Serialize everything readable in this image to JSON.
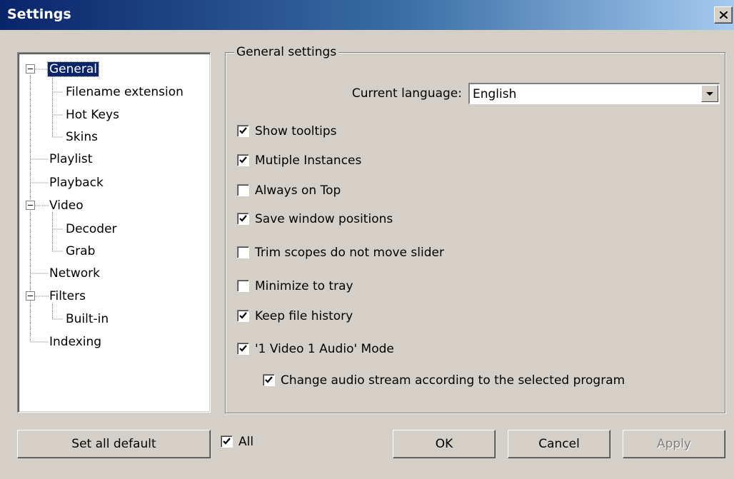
{
  "window": {
    "title": "Settings"
  },
  "tree": {
    "items": [
      {
        "label": "General",
        "selected": true
      },
      {
        "label": "Filename extension"
      },
      {
        "label": "Hot Keys"
      },
      {
        "label": "Skins"
      },
      {
        "label": "Playlist"
      },
      {
        "label": "Playback"
      },
      {
        "label": "Video"
      },
      {
        "label": "Decoder"
      },
      {
        "label": "Grab"
      },
      {
        "label": "Network"
      },
      {
        "label": "Filters"
      },
      {
        "label": "Built-in"
      },
      {
        "label": "Indexing"
      }
    ]
  },
  "general": {
    "legend": "General settings",
    "language_label": "Current language:",
    "language_value": "English",
    "checkboxes": [
      {
        "label": "Show tooltips",
        "checked": true
      },
      {
        "label": "Mutiple Instances",
        "checked": true
      },
      {
        "label": "Always on Top",
        "checked": false
      },
      {
        "label": "Save window positions",
        "checked": true
      },
      {
        "label": "Trim scopes do not move slider",
        "checked": false
      },
      {
        "label": "Minimize to tray",
        "checked": false
      },
      {
        "label": "Keep file history",
        "checked": true
      },
      {
        "label": "'1 Video 1 Audio' Mode",
        "checked": true
      },
      {
        "label": "Change audio stream according to the selected program",
        "checked": true
      }
    ]
  },
  "footer": {
    "set_default": "Set all default",
    "all_label": "All",
    "all_checked": true,
    "ok": "OK",
    "cancel": "Cancel",
    "apply": "Apply"
  }
}
